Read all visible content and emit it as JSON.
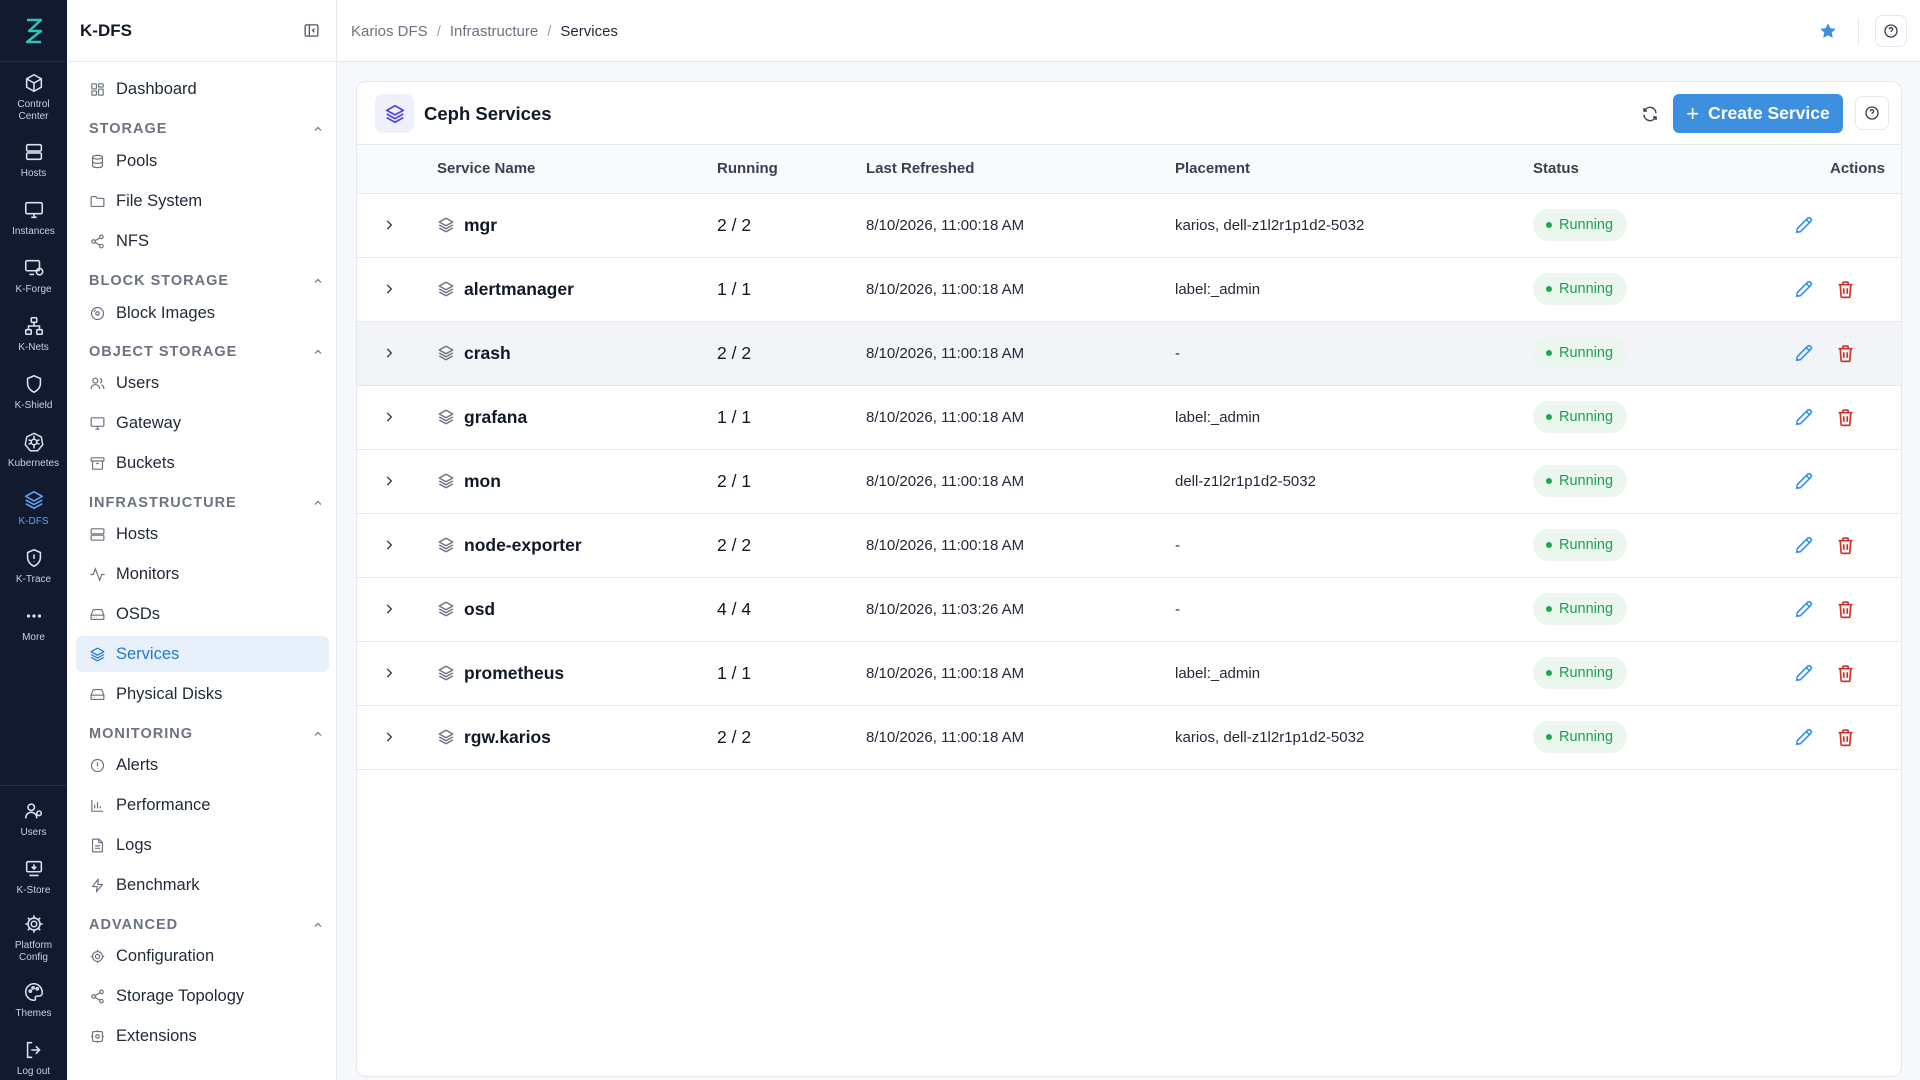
{
  "app": {
    "title": "K-DFS"
  },
  "rail": {
    "items": [
      {
        "label": "Control Center",
        "icon": "cube-icon"
      },
      {
        "label": "Hosts",
        "icon": "server-icon"
      },
      {
        "label": "Instances",
        "icon": "monitor-icon"
      },
      {
        "label": "K-Forge",
        "icon": "forge-icon"
      },
      {
        "label": "K-Nets",
        "icon": "network-icon"
      },
      {
        "label": "K-Shield",
        "icon": "shield-icon"
      },
      {
        "label": "Kubernetes",
        "icon": "kubernetes-icon"
      },
      {
        "label": "K-DFS",
        "icon": "layers-icon",
        "active": true
      },
      {
        "label": "K-Trace",
        "icon": "trace-icon"
      },
      {
        "label": "More",
        "icon": "more-icon"
      }
    ],
    "bottom": [
      {
        "label": "Users",
        "icon": "users-icon"
      },
      {
        "label": "K-Store",
        "icon": "store-icon"
      },
      {
        "label": "Platform Config",
        "icon": "gear-icon"
      },
      {
        "label": "Themes",
        "icon": "palette-icon"
      },
      {
        "label": "Log out",
        "icon": "logout-icon"
      }
    ]
  },
  "sidebar": {
    "dashboard": "Dashboard",
    "sections": {
      "storage": "STORAGE",
      "block": "BLOCK STORAGE",
      "object": "OBJECT STORAGE",
      "infra": "INFRASTRUCTURE",
      "monitoring": "MONITORING",
      "advanced": "ADVANCED"
    },
    "items": {
      "pools": "Pools",
      "filesystem": "File System",
      "nfs": "NFS",
      "block_images": "Block Images",
      "users": "Users",
      "gateway": "Gateway",
      "buckets": "Buckets",
      "hosts": "Hosts",
      "monitors": "Monitors",
      "osds": "OSDs",
      "services": "Services",
      "physical_disks": "Physical Disks",
      "alerts": "Alerts",
      "performance": "Performance",
      "logs": "Logs",
      "benchmark": "Benchmark",
      "configuration": "Configuration",
      "storage_topology": "Storage Topology",
      "extensions": "Extensions"
    }
  },
  "breadcrumb": {
    "root": "Karios DFS",
    "section": "Infrastructure",
    "current": "Services"
  },
  "page": {
    "title": "Ceph Services",
    "create_label": "Create Service"
  },
  "table": {
    "columns": {
      "name": "Service Name",
      "running": "Running",
      "refreshed": "Last Refreshed",
      "placement": "Placement",
      "status": "Status",
      "actions": "Actions"
    },
    "rows": [
      {
        "name": "mgr",
        "running": "2 / 2",
        "refreshed": "8/10/2026, 11:00:18 AM",
        "placement": "karios, dell-z1l2r1p1d2-5032",
        "status": "Running",
        "deletable": false
      },
      {
        "name": "alertmanager",
        "running": "1 / 1",
        "refreshed": "8/10/2026, 11:00:18 AM",
        "placement": "label:_admin",
        "status": "Running",
        "deletable": true
      },
      {
        "name": "crash",
        "running": "2 / 2",
        "refreshed": "8/10/2026, 11:00:18 AM",
        "placement": "-",
        "status": "Running",
        "deletable": true
      },
      {
        "name": "grafana",
        "running": "1 / 1",
        "refreshed": "8/10/2026, 11:00:18 AM",
        "placement": "label:_admin",
        "status": "Running",
        "deletable": true
      },
      {
        "name": "mon",
        "running": "2 / 1",
        "refreshed": "8/10/2026, 11:00:18 AM",
        "placement": "dell-z1l2r1p1d2-5032",
        "status": "Running",
        "deletable": false
      },
      {
        "name": "node-exporter",
        "running": "2 / 2",
        "refreshed": "8/10/2026, 11:00:18 AM",
        "placement": "-",
        "status": "Running",
        "deletable": true
      },
      {
        "name": "osd",
        "running": "4 / 4",
        "refreshed": "8/10/2026, 11:03:26 AM",
        "placement": "-",
        "status": "Running",
        "deletable": true
      },
      {
        "name": "prometheus",
        "running": "1 / 1",
        "refreshed": "8/10/2026, 11:00:18 AM",
        "placement": "label:_admin",
        "status": "Running",
        "deletable": true
      },
      {
        "name": "rgw.karios",
        "running": "2 / 2",
        "refreshed": "8/10/2026, 11:00:18 AM",
        "placement": "karios, dell-z1l2r1p1d2-5032",
        "status": "Running",
        "deletable": true
      }
    ]
  },
  "colors": {
    "rail_bg": "#111a2e",
    "accent": "#3d8fe0",
    "status_running": "#1f9d55",
    "delete": "#d0312d"
  }
}
